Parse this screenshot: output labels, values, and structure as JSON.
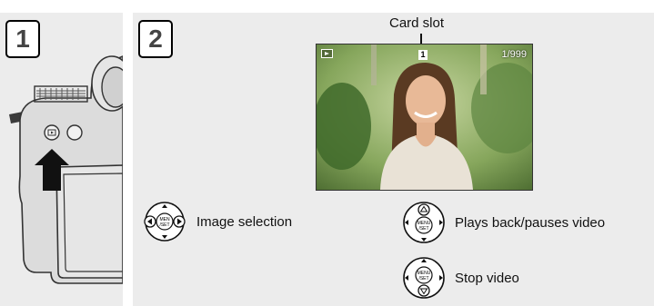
{
  "steps": {
    "step1": "1",
    "step2": "2"
  },
  "lcd": {
    "callout_label": "Card slot",
    "slot_number": "1",
    "image_count": "1/999"
  },
  "instructions": [
    {
      "text": "Image selection",
      "control": "left-right-buttons-icon"
    },
    {
      "text": "Plays back/pauses video",
      "control": "up-button-icon"
    },
    {
      "text": "Stop video",
      "control": "down-button-icon"
    }
  ],
  "colors": {
    "panel_bg": "#ececec",
    "text": "#111111"
  }
}
